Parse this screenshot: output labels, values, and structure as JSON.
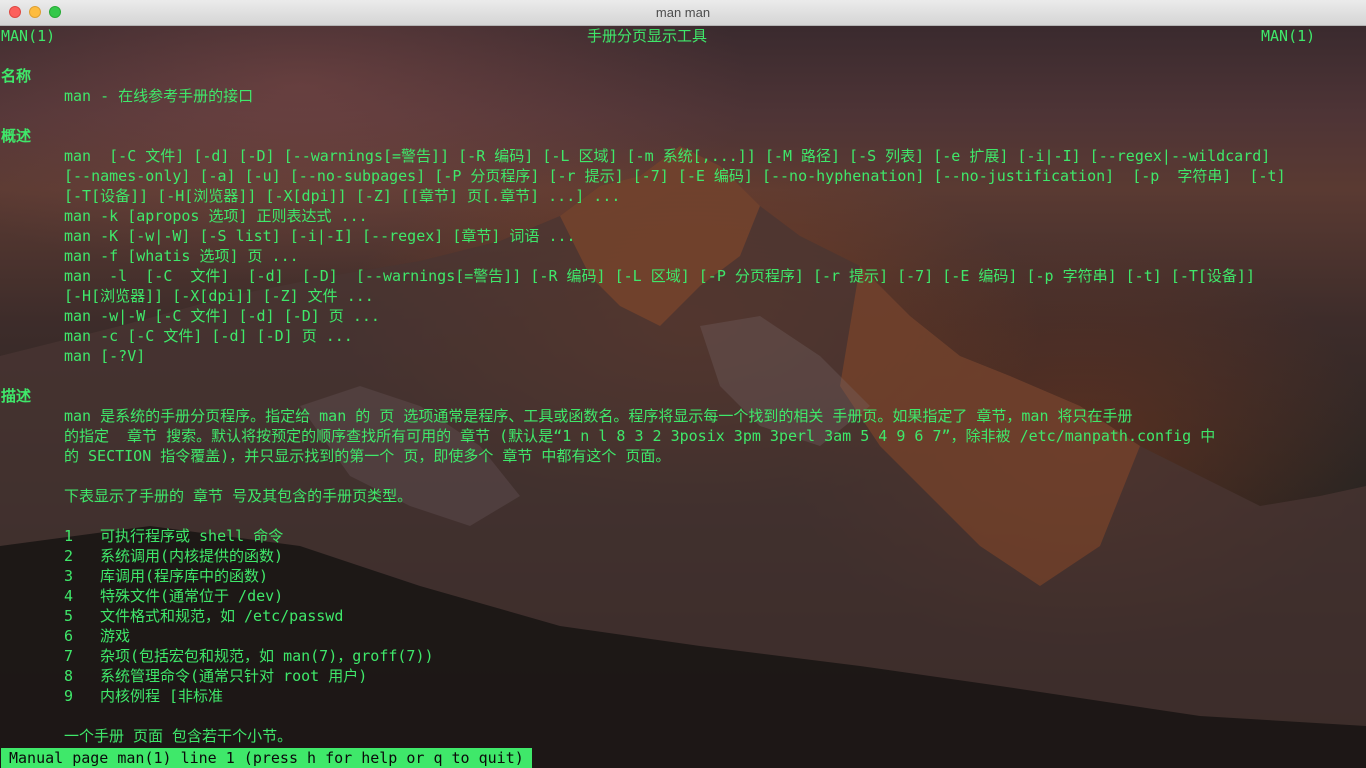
{
  "window": {
    "title": "man man"
  },
  "header": {
    "left": "MAN(1)",
    "center": "手册分页显示工具",
    "right": "MAN(1)"
  },
  "name_section": {
    "heading": "名称",
    "text": "man - 在线参考手册的接口"
  },
  "synopsis": {
    "heading": "概述",
    "lines": [
      "man  [-C 文件] [-d] [-D] [--warnings[=警告]] [-R 编码] [-L 区域] [-m 系统[,...]] [-M 路径] [-S 列表] [-e 扩展] [-i|-I] [--regex|--wildcard]",
      "[--names-only] [-a] [-u] [--no-subpages] [-P 分页程序] [-r 提示] [-7] [-E 编码] [--no-hyphenation] [--no-justification]  [-p  字符串]  [-t]",
      "[-T[设备]] [-H[浏览器]] [-X[dpi]] [-Z] [[章节] 页[.章节] ...] ...",
      "man -k [apropos 选项] 正则表达式 ...",
      "man -K [-w|-W] [-S list] [-i|-I] [--regex] [章节] 词语 ...",
      "man -f [whatis 选项] 页 ...",
      "man  -l  [-C  文件]  [-d]  [-D]  [--warnings[=警告]] [-R 编码] [-L 区域] [-P 分页程序] [-r 提示] [-7] [-E 编码] [-p 字符串] [-t] [-T[设备]]",
      "[-H[浏览器]] [-X[dpi]] [-Z] 文件 ...",
      "man -w|-W [-C 文件] [-d] [-D] 页 ...",
      "man -c [-C 文件] [-d] [-D] 页 ...",
      "man [-?V]"
    ]
  },
  "description": {
    "heading": "描述",
    "paragraph": [
      "man 是系统的手册分页程序。指定给 man 的 页 选项通常是程序、工具或函数名。程序将显示每一个找到的相关 手册页。如果指定了 章节，man 将只在手册",
      "的指定  章节 搜索。默认将按预定的顺序查找所有可用的 章节 (默认是“1 n l 8 3 2 3posix 3pm 3perl 3am 5 4 9 6 7”，除非被 /etc/manpath.config 中",
      "的 SECTION 指令覆盖)，并只显示找到的第一个 页，即使多个 章节 中都有这个 页面。"
    ],
    "table_intro": "下表显示了手册的 章节 号及其包含的手册页类型。",
    "sections": [
      {
        "num": "1",
        "desc": "可执行程序或 shell 命令"
      },
      {
        "num": "2",
        "desc": "系统调用(内核提供的函数)"
      },
      {
        "num": "3",
        "desc": "库调用(程序库中的函数)"
      },
      {
        "num": "4",
        "desc": "特殊文件(通常位于 /dev)"
      },
      {
        "num": "5",
        "desc": "文件格式和规范，如 /etc/passwd"
      },
      {
        "num": "6",
        "desc": "游戏"
      },
      {
        "num": "7",
        "desc": "杂项(包括宏包和规范，如 man(7)，groff(7))"
      },
      {
        "num": "8",
        "desc": "系统管理命令(通常只针对 root 用户)"
      },
      {
        "num": "9",
        "desc": "内核例程 [非标准"
      }
    ],
    "last_line": "一个手册 页面 包含若干个小节。"
  },
  "status_bar": {
    "text": "Manual page man(1) line 1 (press h for help or q to quit)"
  },
  "colors": {
    "text": "#3fe86a",
    "status_bg": "#3fe86a"
  }
}
